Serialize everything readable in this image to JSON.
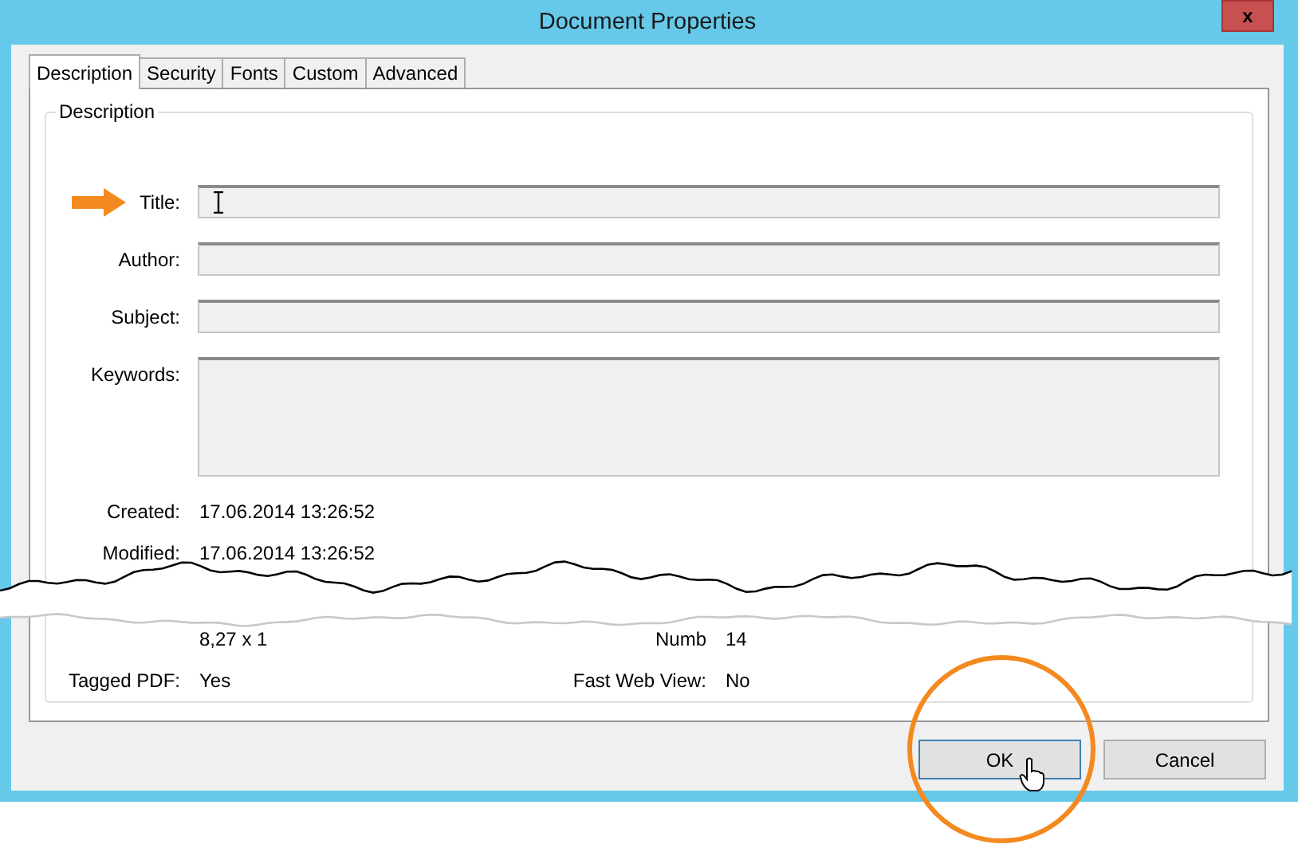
{
  "window": {
    "title": "Document Properties",
    "close": "x"
  },
  "tabs": [
    {
      "label": "Description",
      "selected": true
    },
    {
      "label": "Security",
      "selected": false
    },
    {
      "label": "Fonts",
      "selected": false
    },
    {
      "label": "Custom",
      "selected": false
    },
    {
      "label": "Advanced",
      "selected": false
    }
  ],
  "group": {
    "title": "Description"
  },
  "fields": [
    {
      "label": "Title:",
      "kind": "text",
      "highlighted": true,
      "focused": true
    },
    {
      "label": "Author:",
      "kind": "text",
      "highlighted": false,
      "focused": false
    },
    {
      "label": "Subject:",
      "kind": "text",
      "highlighted": false,
      "focused": false
    },
    {
      "label": "Keywords:",
      "kind": "multiline",
      "highlighted": false,
      "focused": false
    }
  ],
  "info_rows": [
    {
      "left": {
        "label": "Created:",
        "value": "17.06.2014 13:26:52"
      }
    },
    {
      "left": {
        "label": "Modified:",
        "value": "17.06.2014 13:26:52"
      }
    },
    {
      "left": {
        "value": "8,27 x 1"
      },
      "right": {
        "label": "Numb",
        "value": "14"
      }
    },
    {
      "left": {
        "label": "Tagged PDF:",
        "value": "Yes"
      },
      "right": {
        "label": "Fast Web View:",
        "value": "No"
      }
    }
  ],
  "buttons": [
    {
      "label": "OK",
      "default": true,
      "highlighted": true,
      "hovered": true
    },
    {
      "label": "Cancel",
      "default": false,
      "highlighted": false,
      "hovered": false
    }
  ]
}
